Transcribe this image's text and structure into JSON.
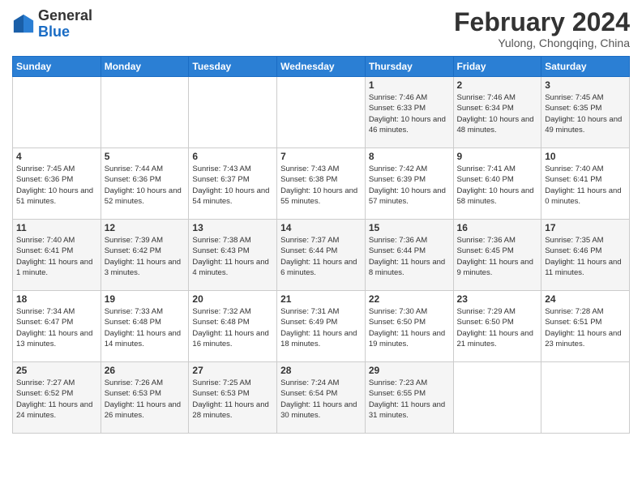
{
  "header": {
    "logo_line1": "General",
    "logo_line2": "Blue",
    "title": "February 2024",
    "subtitle": "Yulong, Chongqing, China"
  },
  "weekdays": [
    "Sunday",
    "Monday",
    "Tuesday",
    "Wednesday",
    "Thursday",
    "Friday",
    "Saturday"
  ],
  "weeks": [
    [
      {
        "day": "",
        "sunrise": "",
        "sunset": "",
        "daylight": ""
      },
      {
        "day": "",
        "sunrise": "",
        "sunset": "",
        "daylight": ""
      },
      {
        "day": "",
        "sunrise": "",
        "sunset": "",
        "daylight": ""
      },
      {
        "day": "",
        "sunrise": "",
        "sunset": "",
        "daylight": ""
      },
      {
        "day": "1",
        "sunrise": "Sunrise: 7:46 AM",
        "sunset": "Sunset: 6:33 PM",
        "daylight": "Daylight: 10 hours and 46 minutes."
      },
      {
        "day": "2",
        "sunrise": "Sunrise: 7:46 AM",
        "sunset": "Sunset: 6:34 PM",
        "daylight": "Daylight: 10 hours and 48 minutes."
      },
      {
        "day": "3",
        "sunrise": "Sunrise: 7:45 AM",
        "sunset": "Sunset: 6:35 PM",
        "daylight": "Daylight: 10 hours and 49 minutes."
      }
    ],
    [
      {
        "day": "4",
        "sunrise": "Sunrise: 7:45 AM",
        "sunset": "Sunset: 6:36 PM",
        "daylight": "Daylight: 10 hours and 51 minutes."
      },
      {
        "day": "5",
        "sunrise": "Sunrise: 7:44 AM",
        "sunset": "Sunset: 6:36 PM",
        "daylight": "Daylight: 10 hours and 52 minutes."
      },
      {
        "day": "6",
        "sunrise": "Sunrise: 7:43 AM",
        "sunset": "Sunset: 6:37 PM",
        "daylight": "Daylight: 10 hours and 54 minutes."
      },
      {
        "day": "7",
        "sunrise": "Sunrise: 7:43 AM",
        "sunset": "Sunset: 6:38 PM",
        "daylight": "Daylight: 10 hours and 55 minutes."
      },
      {
        "day": "8",
        "sunrise": "Sunrise: 7:42 AM",
        "sunset": "Sunset: 6:39 PM",
        "daylight": "Daylight: 10 hours and 57 minutes."
      },
      {
        "day": "9",
        "sunrise": "Sunrise: 7:41 AM",
        "sunset": "Sunset: 6:40 PM",
        "daylight": "Daylight: 10 hours and 58 minutes."
      },
      {
        "day": "10",
        "sunrise": "Sunrise: 7:40 AM",
        "sunset": "Sunset: 6:41 PM",
        "daylight": "Daylight: 11 hours and 0 minutes."
      }
    ],
    [
      {
        "day": "11",
        "sunrise": "Sunrise: 7:40 AM",
        "sunset": "Sunset: 6:41 PM",
        "daylight": "Daylight: 11 hours and 1 minute."
      },
      {
        "day": "12",
        "sunrise": "Sunrise: 7:39 AM",
        "sunset": "Sunset: 6:42 PM",
        "daylight": "Daylight: 11 hours and 3 minutes."
      },
      {
        "day": "13",
        "sunrise": "Sunrise: 7:38 AM",
        "sunset": "Sunset: 6:43 PM",
        "daylight": "Daylight: 11 hours and 4 minutes."
      },
      {
        "day": "14",
        "sunrise": "Sunrise: 7:37 AM",
        "sunset": "Sunset: 6:44 PM",
        "daylight": "Daylight: 11 hours and 6 minutes."
      },
      {
        "day": "15",
        "sunrise": "Sunrise: 7:36 AM",
        "sunset": "Sunset: 6:44 PM",
        "daylight": "Daylight: 11 hours and 8 minutes."
      },
      {
        "day": "16",
        "sunrise": "Sunrise: 7:36 AM",
        "sunset": "Sunset: 6:45 PM",
        "daylight": "Daylight: 11 hours and 9 minutes."
      },
      {
        "day": "17",
        "sunrise": "Sunrise: 7:35 AM",
        "sunset": "Sunset: 6:46 PM",
        "daylight": "Daylight: 11 hours and 11 minutes."
      }
    ],
    [
      {
        "day": "18",
        "sunrise": "Sunrise: 7:34 AM",
        "sunset": "Sunset: 6:47 PM",
        "daylight": "Daylight: 11 hours and 13 minutes."
      },
      {
        "day": "19",
        "sunrise": "Sunrise: 7:33 AM",
        "sunset": "Sunset: 6:48 PM",
        "daylight": "Daylight: 11 hours and 14 minutes."
      },
      {
        "day": "20",
        "sunrise": "Sunrise: 7:32 AM",
        "sunset": "Sunset: 6:48 PM",
        "daylight": "Daylight: 11 hours and 16 minutes."
      },
      {
        "day": "21",
        "sunrise": "Sunrise: 7:31 AM",
        "sunset": "Sunset: 6:49 PM",
        "daylight": "Daylight: 11 hours and 18 minutes."
      },
      {
        "day": "22",
        "sunrise": "Sunrise: 7:30 AM",
        "sunset": "Sunset: 6:50 PM",
        "daylight": "Daylight: 11 hours and 19 minutes."
      },
      {
        "day": "23",
        "sunrise": "Sunrise: 7:29 AM",
        "sunset": "Sunset: 6:50 PM",
        "daylight": "Daylight: 11 hours and 21 minutes."
      },
      {
        "day": "24",
        "sunrise": "Sunrise: 7:28 AM",
        "sunset": "Sunset: 6:51 PM",
        "daylight": "Daylight: 11 hours and 23 minutes."
      }
    ],
    [
      {
        "day": "25",
        "sunrise": "Sunrise: 7:27 AM",
        "sunset": "Sunset: 6:52 PM",
        "daylight": "Daylight: 11 hours and 24 minutes."
      },
      {
        "day": "26",
        "sunrise": "Sunrise: 7:26 AM",
        "sunset": "Sunset: 6:53 PM",
        "daylight": "Daylight: 11 hours and 26 minutes."
      },
      {
        "day": "27",
        "sunrise": "Sunrise: 7:25 AM",
        "sunset": "Sunset: 6:53 PM",
        "daylight": "Daylight: 11 hours and 28 minutes."
      },
      {
        "day": "28",
        "sunrise": "Sunrise: 7:24 AM",
        "sunset": "Sunset: 6:54 PM",
        "daylight": "Daylight: 11 hours and 30 minutes."
      },
      {
        "day": "29",
        "sunrise": "Sunrise: 7:23 AM",
        "sunset": "Sunset: 6:55 PM",
        "daylight": "Daylight: 11 hours and 31 minutes."
      },
      {
        "day": "",
        "sunrise": "",
        "sunset": "",
        "daylight": ""
      },
      {
        "day": "",
        "sunrise": "",
        "sunset": "",
        "daylight": ""
      }
    ]
  ]
}
